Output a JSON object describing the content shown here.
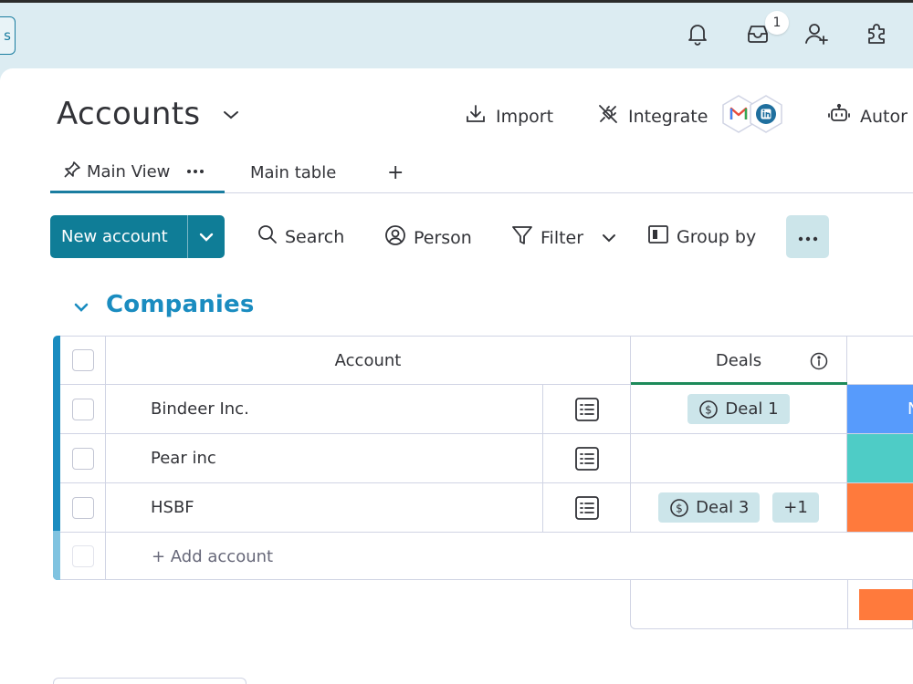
{
  "topbar": {
    "side_button_label": "s",
    "inbox_badge": "1",
    "icons": [
      "bell-icon",
      "inbox-icon",
      "invite-user-icon",
      "integrations-puzzle-icon"
    ]
  },
  "board": {
    "title": "Accounts",
    "actions": {
      "import_label": "Import",
      "integrate_label": "Integrate",
      "automate_label": "Autor"
    },
    "tabs": [
      {
        "label": "Main View",
        "active": true
      },
      {
        "label": "Main table",
        "active": false
      }
    ],
    "add_tab_label": "+"
  },
  "toolbar": {
    "new_button_label": "New account",
    "search_label": "Search",
    "person_label": "Person",
    "filter_label": "Filter",
    "group_by_label": "Group by"
  },
  "group": {
    "title": "Companies",
    "color": "#1a8cc0",
    "columns": {
      "account": "Account",
      "deals": "Deals"
    },
    "rows": [
      {
        "name": "Bindeer Inc.",
        "deals": [
          "Deal 1"
        ],
        "extra_count": "",
        "status_color": "#579bfc",
        "status_text": "N"
      },
      {
        "name": "Pear inc",
        "deals": [],
        "extra_count": "",
        "status_color": "#4eccc6",
        "status_text": ""
      },
      {
        "name": "HSBF",
        "deals": [
          "Deal 3"
        ],
        "extra_count": "+1",
        "status_color": "#ff7a3c",
        "status_text": ""
      }
    ],
    "add_row_label": "+ Add account"
  },
  "colors": {
    "primary": "#0f7d97",
    "chip_bg": "#cce5ea",
    "deals_underline": "#1d8a5a"
  }
}
